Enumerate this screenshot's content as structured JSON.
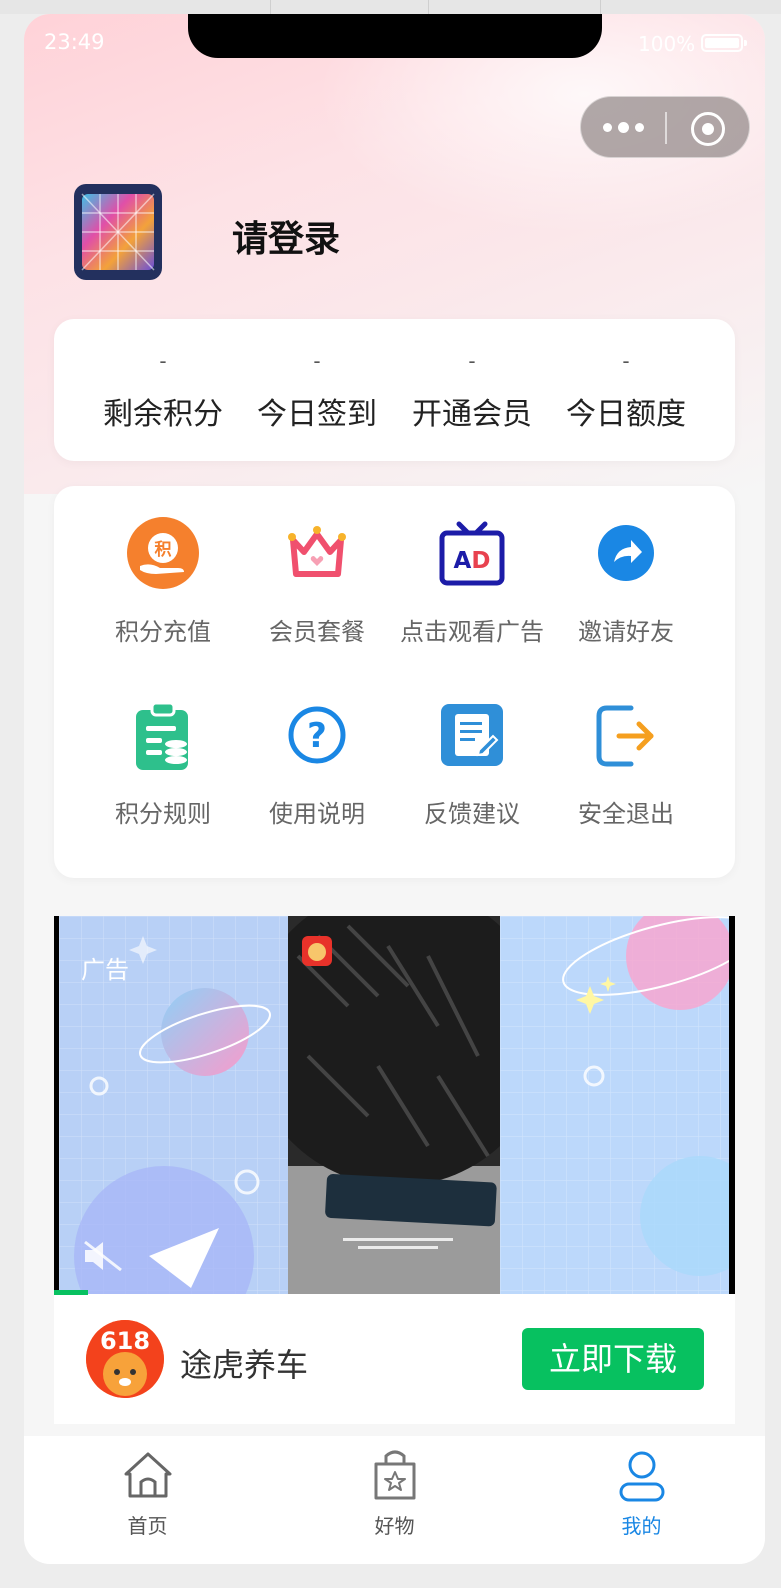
{
  "status_bar": {
    "time": "23:49",
    "battery": "100%"
  },
  "profile": {
    "login_prompt": "请登录"
  },
  "stats": [
    {
      "value": "-",
      "label": "剩余积分"
    },
    {
      "value": "-",
      "label": "今日签到"
    },
    {
      "value": "-",
      "label": "开通会员"
    },
    {
      "value": "-",
      "label": "今日额度"
    }
  ],
  "menu": [
    {
      "label": "积分充值",
      "icon": "points-recharge-icon"
    },
    {
      "label": "会员套餐",
      "icon": "crown-icon"
    },
    {
      "label": "点击观看广告",
      "icon": "ad-tv-icon"
    },
    {
      "label": "邀请好友",
      "icon": "share-arrow-icon"
    },
    {
      "label": "积分规则",
      "icon": "clipboard-coins-icon"
    },
    {
      "label": "使用说明",
      "icon": "question-icon"
    },
    {
      "label": "反馈建议",
      "icon": "edit-document-icon"
    },
    {
      "label": "安全退出",
      "icon": "logout-icon"
    }
  ],
  "ad": {
    "tag": "广告",
    "app_name": "途虎养车",
    "logo_text": "618",
    "button": "立即下载"
  },
  "tabbar": [
    {
      "label": "首页",
      "icon": "home-icon"
    },
    {
      "label": "好物",
      "icon": "shopping-bag-icon"
    },
    {
      "label": "我的",
      "icon": "user-icon",
      "active": true
    }
  ],
  "colors": {
    "accent_blue": "#1a87e4",
    "download_green": "#07c160",
    "orange": "#f5802d",
    "crown_pink": "#f0506e"
  }
}
